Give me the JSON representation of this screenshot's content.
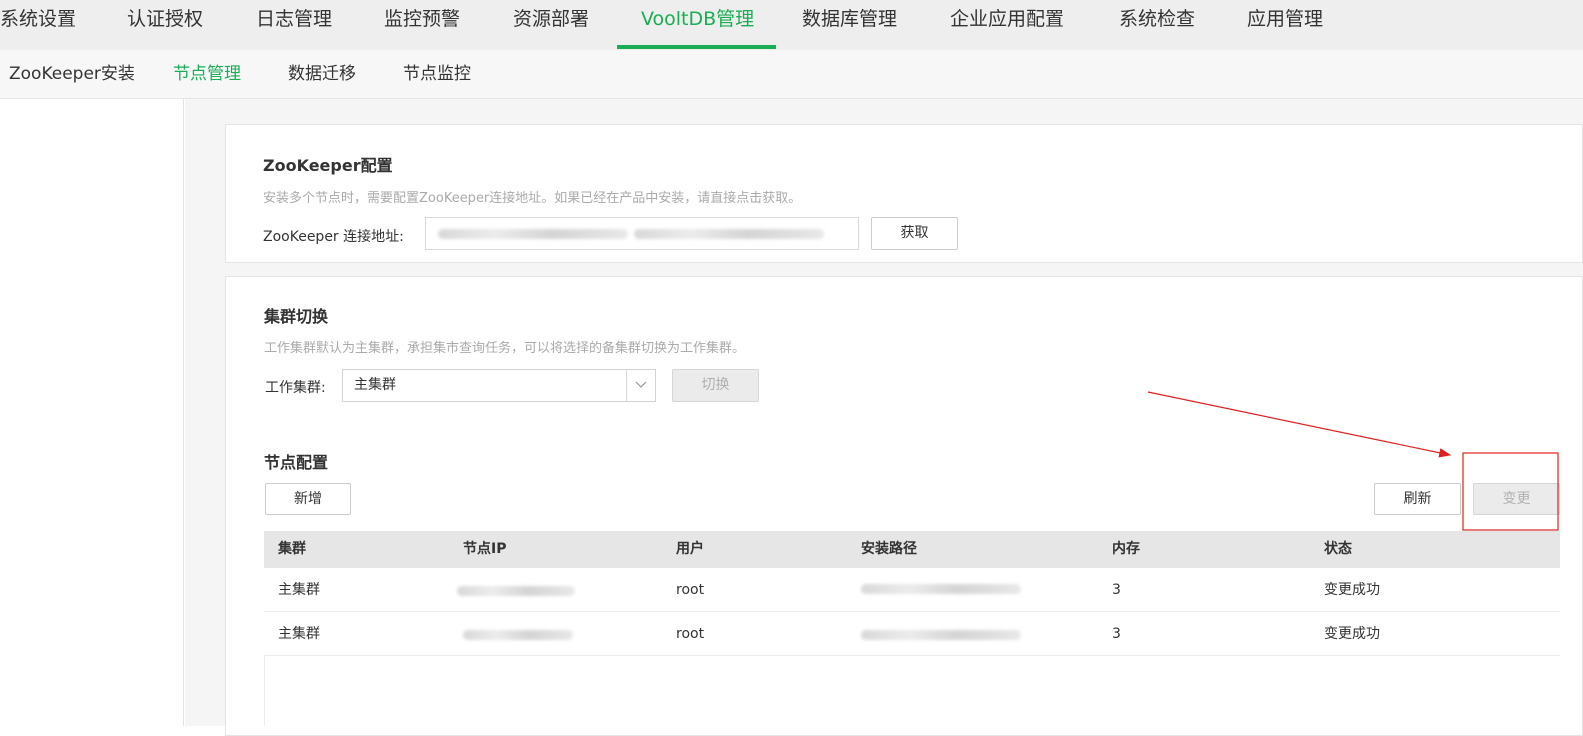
{
  "topnav": {
    "items": [
      "系统设置",
      "认证授权",
      "日志管理",
      "监控预警",
      "资源部署",
      "VooltDB管理",
      "数据库管理",
      "企业应用配置",
      "系统检查",
      "应用管理"
    ],
    "active_index": 5
  },
  "subnav": {
    "items": [
      "ZooKeeper安装",
      "节点管理",
      "数据迁移",
      "节点监控"
    ],
    "active_index": 1
  },
  "zookeeper": {
    "title": "ZooKeeper配置",
    "desc": "安装多个节点时，需要配置ZooKeeper连接地址。如果已经在产品中安装，请直接点击获取。",
    "addr_label": "ZooKeeper 连接地址:",
    "fetch_button": "获取"
  },
  "cluster_switch": {
    "title": "集群切换",
    "desc": "工作集群默认为主集群，承担集市查询任务，可以将选择的备集群切换为工作集群。",
    "label": "工作集群:",
    "selected": "主集群",
    "switch_button": "切换"
  },
  "node_config": {
    "title": "节点配置",
    "add_button": "新增",
    "refresh_button": "刷新",
    "change_button": "变更",
    "columns": [
      "集群",
      "节点IP",
      "用户",
      "安装路径",
      "内存",
      "状态"
    ],
    "rows": [
      {
        "cluster": "主集群",
        "user": "root",
        "memory": "3",
        "status": "变更成功"
      },
      {
        "cluster": "主集群",
        "user": "root",
        "memory": "3",
        "status": "变更成功"
      }
    ]
  },
  "colors": {
    "accent": "#1aad54",
    "annotation": "#e02020"
  },
  "icons": {
    "select_arrow": "chevron-down-icon"
  }
}
